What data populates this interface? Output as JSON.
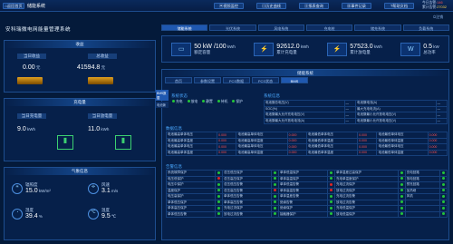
{
  "topbar": {
    "home": "返回首页",
    "title": "储能系统",
    "btns": [
      "视频监控",
      "历史曲线",
      "报表查询",
      "事件记录",
      "帮助文档"
    ],
    "today_label": "今日告警:",
    "today_count": "146",
    "total_label": "累计告警:",
    "total_count": "27032",
    "user": "注销",
    "date": "2023-09-28",
    "time": "14:59:26"
  },
  "system_title": "安科瑞微电网能量管理系统",
  "tabs_top": [
    "储能系统",
    "光伏系统",
    "风电系统",
    "充电桩",
    "储充系统",
    "负载系统"
  ],
  "stats": [
    {
      "value": "50 kW /100",
      "unit": "kWh",
      "label": "额定容量"
    },
    {
      "value": "92612.0",
      "unit": "kWh",
      "label": "累计充电量"
    },
    {
      "value": "57523.0",
      "unit": "kWh",
      "label": "累计放电量"
    },
    {
      "value": "0.5",
      "unit": "kW",
      "label": "总功率"
    }
  ],
  "left": {
    "panel1": {
      "title": "收益",
      "today_label": "当日收益",
      "total_label": "总收益",
      "today": "0.00",
      "total": "41594.8",
      "unit": "元"
    },
    "panel2": {
      "title": "充电量",
      "today_label": "当日充电量",
      "total_label": "当日放电量",
      "today": "9.0",
      "total": "11.0",
      "unit": "kWh"
    },
    "panel3": {
      "title": "气象信息",
      "items": [
        {
          "label": "辐照度",
          "value": "15.0",
          "unit": "kW/m²"
        },
        {
          "label": "风速",
          "value": "3.1",
          "unit": "m/s"
        },
        {
          "label": "湿度",
          "value": "39.4",
          "unit": "%"
        },
        {
          "label": "温度",
          "value": "9.5",
          "unit": "℃"
        }
      ]
    }
  },
  "rt": {
    "title": "储能系统",
    "tabs": [
      "首页",
      "参数设置",
      "PCS数据",
      "PCS状态",
      "BMS"
    ],
    "active_tab": 4
  },
  "bms": {
    "side": [
      "BMS数据",
      "电池簇"
    ],
    "sys_state_title": "系统状态",
    "states": [
      "充电",
      "放电",
      "静置",
      "待机",
      "保护"
    ],
    "sys_info_title": "系统信息",
    "sys_info": [
      [
        "电池簇总电压(V)",
        "—",
        "电池簇电流(A)",
        "—"
      ],
      [
        "SOC(%)",
        "—",
        "最大充电电流(A)",
        "—"
      ],
      [
        "电池簇最大允许充电电压(V)",
        "—",
        "电池簇最小允许放电电压(V)",
        "—"
      ],
      [
        "电池簇最大允许放电电流(A)",
        "—",
        "电池簇最小允许放电电压(V)",
        "—"
      ]
    ],
    "data_title": "数据信息",
    "data_rows": [
      [
        "电池最高单体电压",
        "0.000",
        "电池最高单体电压",
        "0.000",
        "电池最低单体电压",
        "0.000",
        "电池最低单体电压",
        "0.000"
      ],
      [
        "电池最高单体温度",
        "0.000",
        "电池最高单体温度",
        "0.000",
        "电池最低单体温度",
        "0.000",
        "电池最低单体温度",
        "0.000"
      ],
      [
        "电池最高单体电压",
        "0.000",
        "电池最高单体电压",
        "0.000",
        "电池最低单体电压",
        "0.000",
        "电池最低单体电压",
        "0.000"
      ],
      [
        "电池最高单体温度",
        "0.000",
        "电池最高单体温度",
        "0.000",
        "电池最低单体温度",
        "0.000",
        "电池最低单体温度",
        "0.000"
      ]
    ],
    "alarm_title": "告警信息",
    "alarms": [
      [
        "系统故障保护",
        "g",
        "总压低压保护",
        "g",
        "单体低温保护",
        "g",
        "单体温差过高保护",
        "g",
        "充电回路",
        "g"
      ],
      [
        "电压低保护",
        "r",
        "总压高压保护",
        "g",
        "单体高温保护",
        "g",
        "充电单温度保护",
        "g",
        "放电回路",
        "g"
      ],
      [
        "电压中保护",
        "g",
        "总压低压告警",
        "g",
        "单体低温告警",
        "r",
        "充电过流保护",
        "g",
        "预充回路",
        "g"
      ],
      [
        "温度保护",
        "g",
        "总压高压告警",
        "r",
        "单体高温告警",
        "r",
        "放电过流保护",
        "g",
        "加热继",
        "g"
      ],
      [
        "电压高保护",
        "g",
        "单体低压告警",
        "g",
        "单体温差告警",
        "g",
        "充电过流告警",
        "g",
        "风机",
        "g"
      ],
      [
        "单体低压保护",
        "g",
        "单体高压告警",
        "g",
        "绝缘告警",
        "g",
        "放电过流告警",
        "g",
        "",
        "g"
      ],
      [
        "单体高压保护",
        "g",
        "充电过流保护",
        "g",
        "绝缘保护",
        "g",
        "充电低温保护",
        "g",
        "",
        "g"
      ],
      [
        "单体低压告警",
        "g",
        "放电过流告警",
        "g",
        "接触器保护",
        "g",
        "放电低温保护",
        "g",
        "",
        "g"
      ]
    ]
  }
}
